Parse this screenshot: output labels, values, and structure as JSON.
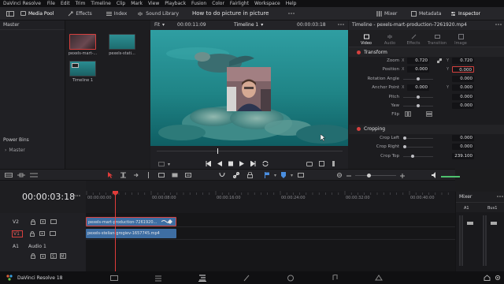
{
  "menu": {
    "app_name": "DaVinci Resolve",
    "items": [
      "File",
      "Edit",
      "Trim",
      "Timeline",
      "Clip",
      "Mark",
      "View",
      "Playback",
      "Fusion",
      "Color",
      "Fairlight",
      "Workspace",
      "Help"
    ]
  },
  "toolbar": {
    "media_pool": "Media Pool",
    "effects": "Effects",
    "index": "Index",
    "sound_library": "Sound Library",
    "project_title": "How to do picture in picture",
    "mixer": "Mixer",
    "metadata": "Metadata",
    "inspector": "Inspector"
  },
  "bins": {
    "master": "Master",
    "power_bins": "Power Bins",
    "power_master": "Master"
  },
  "media_pool": {
    "clips": [
      {
        "label": "pexels-mart-..."
      },
      {
        "label": "pexels-stati..."
      },
      {
        "label": "Timeline 1"
      }
    ]
  },
  "viewer": {
    "fit": "Fit",
    "source_tc": "00:00:11:09",
    "timeline_name": "Timeline 1",
    "record_tc": "00:00:03:18"
  },
  "inspector": {
    "title": "Timeline - pexels-mart-production-7261920.mp4",
    "tabs": [
      "Video",
      "Audio",
      "Effects",
      "Transition",
      "Image"
    ],
    "transform": {
      "label": "Transform",
      "rows": [
        {
          "label": "Zoom",
          "x": "0.720",
          "y": "0.720"
        },
        {
          "label": "Position",
          "x": "0.000",
          "y": "0.000"
        },
        {
          "label": "Rotation Angle",
          "value": "0.000"
        },
        {
          "label": "Anchor Point",
          "x": "0.000",
          "y": "0.000"
        },
        {
          "label": "Pitch",
          "value": "0.000"
        },
        {
          "label": "Yaw",
          "value": "0.000"
        },
        {
          "label": "Flip"
        }
      ]
    },
    "cropping": {
      "label": "Cropping",
      "rows": [
        {
          "label": "Crop Left",
          "value": "0.000"
        },
        {
          "label": "Crop Right",
          "value": "0.000"
        },
        {
          "label": "Crop Top",
          "value": "239.100"
        }
      ]
    }
  },
  "timeline": {
    "timecode": "00:00:03:18",
    "ruler_ticks": [
      "00:00:00:00",
      "00:00:08:00",
      "00:00:16:00",
      "00:00:24:00",
      "00:00:32:00",
      "00:00:40:00"
    ],
    "tracks": [
      {
        "name": "V2"
      },
      {
        "name": "V1"
      },
      {
        "name": "A1",
        "label": "Audio 1"
      }
    ],
    "clips": [
      {
        "label": "pexels-mart-production-7261920..."
      },
      {
        "label": "pexels-stelian-grogiev-1657745.mp4"
      }
    ]
  },
  "mixer": {
    "label": "Mixer",
    "channels": [
      "A1",
      "Bus1"
    ]
  },
  "status": {
    "app_version": "DaVinci Resolve 18"
  },
  "colors": {
    "accent_red": "#d6403e",
    "clip_blue": "#3e6ea3",
    "playhead": "#e03c3a"
  }
}
